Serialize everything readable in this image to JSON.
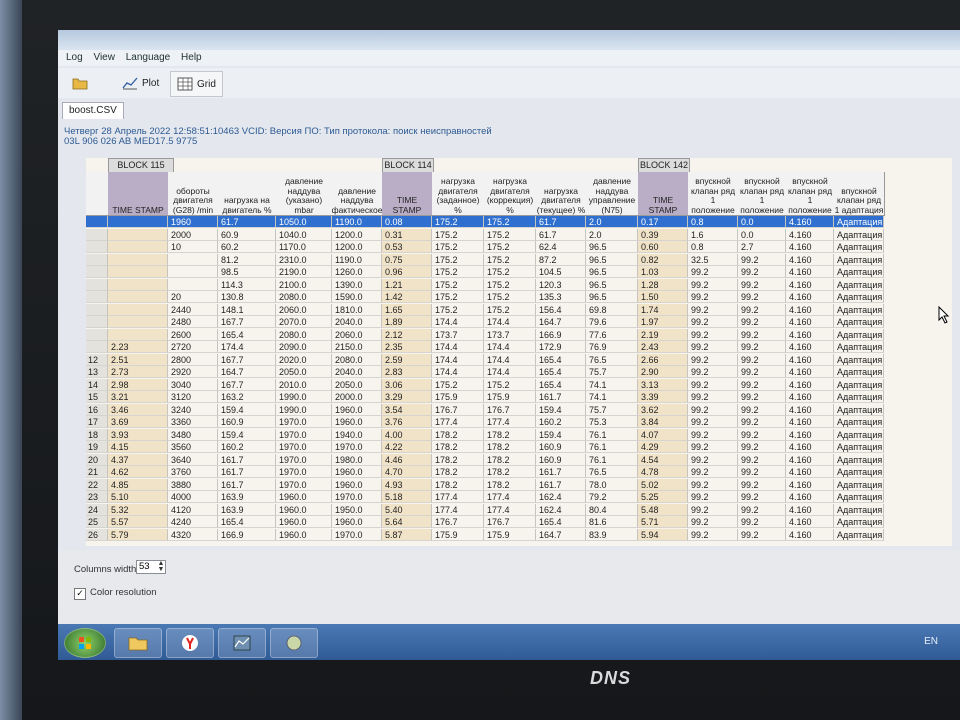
{
  "menu": [
    "Log",
    "View",
    "Language",
    "Help"
  ],
  "toolbar": {
    "plot_label": "Plot",
    "grid_label": "Grid"
  },
  "file_tab": "boost.CSV",
  "info_line1": "Четверг 28 Апрель 2022 12:58:51:10463 VCID: Версия ПО: Тип протокола: поиск неисправностей",
  "info_line2": "03L 906 026 AB  MED17.5                    9775",
  "blocks": [
    {
      "label": "BLOCK 115"
    },
    {
      "label": "BLOCK 114"
    },
    {
      "label": "BLOCK 142"
    }
  ],
  "columns": [
    "TIME STAMP",
    "обороты двигателя (G28) /min",
    "нагрузка на двигатель %",
    "давление наддува (указано) mbar",
    "давление наддува фактическое",
    "TIME STAMP",
    "нагрузка двигателя (заданное) %",
    "нагрузка двигателя (коррекция) %",
    "нагрузка двигателя (текущее) %",
    "давление наддува управление (N75)",
    "TIME STAMP",
    "впускной клапан ряд 1 положение",
    "впускной клапан ряд 1 положение",
    "впускной клапан ряд 1 положение",
    "впускной клапан ряд 1 адаптация"
  ],
  "rows": [
    [
      "",
      "",
      "1960",
      "61.7",
      "1050.0",
      "1190.0",
      "0.08",
      "175.2",
      "175.2",
      "61.7",
      "2.0",
      "0.17",
      "0.8",
      "0.0",
      "4.160",
      "Адаптация"
    ],
    [
      "",
      "",
      "2000",
      "60.9",
      "1040.0",
      "1200.0",
      "0.31",
      "175.2",
      "175.2",
      "61.7",
      "2.0",
      "0.39",
      "1.6",
      "0.0",
      "4.160",
      "Адаптация"
    ],
    [
      "",
      "",
      "10",
      "60.2",
      "1170.0",
      "1200.0",
      "0.53",
      "175.2",
      "175.2",
      "62.4",
      "96.5",
      "0.60",
      "0.8",
      "2.7",
      "4.160",
      "Адаптация"
    ],
    [
      "",
      "",
      "",
      "81.2",
      "2310.0",
      "1190.0",
      "0.75",
      "175.2",
      "175.2",
      "87.2",
      "96.5",
      "0.82",
      "32.5",
      "99.2",
      "4.160",
      "Адаптация"
    ],
    [
      "",
      "",
      "",
      "98.5",
      "2190.0",
      "1260.0",
      "0.96",
      "175.2",
      "175.2",
      "104.5",
      "96.5",
      "1.03",
      "99.2",
      "99.2",
      "4.160",
      "Адаптация"
    ],
    [
      "",
      "",
      "",
      "114.3",
      "2100.0",
      "1390.0",
      "1.21",
      "175.2",
      "175.2",
      "120.3",
      "96.5",
      "1.28",
      "99.2",
      "99.2",
      "4.160",
      "Адаптация"
    ],
    [
      "",
      "",
      "20",
      "130.8",
      "2080.0",
      "1590.0",
      "1.42",
      "175.2",
      "175.2",
      "135.3",
      "96.5",
      "1.50",
      "99.2",
      "99.2",
      "4.160",
      "Адаптация"
    ],
    [
      "",
      "",
      "2440",
      "148.1",
      "2060.0",
      "1810.0",
      "1.65",
      "175.2",
      "175.2",
      "156.4",
      "69.8",
      "1.74",
      "99.2",
      "99.2",
      "4.160",
      "Адаптация"
    ],
    [
      "",
      "",
      "2480",
      "167.7",
      "2070.0",
      "2040.0",
      "1.89",
      "174.4",
      "174.4",
      "164.7",
      "79.6",
      "1.97",
      "99.2",
      "99.2",
      "4.160",
      "Адаптация"
    ],
    [
      "",
      "",
      "2600",
      "165.4",
      "2080.0",
      "2060.0",
      "2.12",
      "173.7",
      "173.7",
      "166.9",
      "77.6",
      "2.19",
      "99.2",
      "99.2",
      "4.160",
      "Адаптация"
    ],
    [
      "",
      "2.23",
      "2720",
      "174.4",
      "2090.0",
      "2150.0",
      "2.35",
      "174.4",
      "174.4",
      "172.9",
      "76.9",
      "2.43",
      "99.2",
      "99.2",
      "4.160",
      "Адаптация"
    ],
    [
      "12",
      "2.51",
      "2800",
      "167.7",
      "2020.0",
      "2080.0",
      "2.59",
      "174.4",
      "174.4",
      "165.4",
      "76.5",
      "2.66",
      "99.2",
      "99.2",
      "4.160",
      "Адаптация"
    ],
    [
      "13",
      "2.73",
      "2920",
      "164.7",
      "2050.0",
      "2040.0",
      "2.83",
      "174.4",
      "174.4",
      "165.4",
      "75.7",
      "2.90",
      "99.2",
      "99.2",
      "4.160",
      "Адаптация"
    ],
    [
      "14",
      "2.98",
      "3040",
      "167.7",
      "2010.0",
      "2050.0",
      "3.06",
      "175.2",
      "175.2",
      "165.4",
      "74.1",
      "3.13",
      "99.2",
      "99.2",
      "4.160",
      "Адаптация"
    ],
    [
      "15",
      "3.21",
      "3120",
      "163.2",
      "1990.0",
      "2000.0",
      "3.29",
      "175.9",
      "175.9",
      "161.7",
      "74.1",
      "3.39",
      "99.2",
      "99.2",
      "4.160",
      "Адаптация"
    ],
    [
      "16",
      "3.46",
      "3240",
      "159.4",
      "1990.0",
      "1960.0",
      "3.54",
      "176.7",
      "176.7",
      "159.4",
      "75.7",
      "3.62",
      "99.2",
      "99.2",
      "4.160",
      "Адаптация"
    ],
    [
      "17",
      "3.69",
      "3360",
      "160.9",
      "1970.0",
      "1960.0",
      "3.76",
      "177.4",
      "177.4",
      "160.2",
      "75.3",
      "3.84",
      "99.2",
      "99.2",
      "4.160",
      "Адаптация"
    ],
    [
      "18",
      "3.93",
      "3480",
      "159.4",
      "1970.0",
      "1940.0",
      "4.00",
      "178.2",
      "178.2",
      "159.4",
      "76.1",
      "4.07",
      "99.2",
      "99.2",
      "4.160",
      "Адаптация"
    ],
    [
      "19",
      "4.15",
      "3560",
      "160.2",
      "1970.0",
      "1970.0",
      "4.22",
      "178.2",
      "178.2",
      "160.9",
      "76.1",
      "4.29",
      "99.2",
      "99.2",
      "4.160",
      "Адаптация"
    ],
    [
      "20",
      "4.37",
      "3640",
      "161.7",
      "1970.0",
      "1980.0",
      "4.46",
      "178.2",
      "178.2",
      "160.9",
      "76.1",
      "4.54",
      "99.2",
      "99.2",
      "4.160",
      "Адаптация"
    ],
    [
      "21",
      "4.62",
      "3760",
      "161.7",
      "1970.0",
      "1960.0",
      "4.70",
      "178.2",
      "178.2",
      "161.7",
      "76.5",
      "4.78",
      "99.2",
      "99.2",
      "4.160",
      "Адаптация"
    ],
    [
      "22",
      "4.85",
      "3880",
      "161.7",
      "1970.0",
      "1960.0",
      "4.93",
      "178.2",
      "178.2",
      "161.7",
      "78.0",
      "5.02",
      "99.2",
      "99.2",
      "4.160",
      "Адаптация"
    ],
    [
      "23",
      "5.10",
      "4000",
      "163.9",
      "1960.0",
      "1970.0",
      "5.18",
      "177.4",
      "177.4",
      "162.4",
      "79.2",
      "5.25",
      "99.2",
      "99.2",
      "4.160",
      "Адаптация"
    ],
    [
      "24",
      "5.32",
      "4120",
      "163.9",
      "1960.0",
      "1950.0",
      "5.40",
      "177.4",
      "177.4",
      "162.4",
      "80.4",
      "5.48",
      "99.2",
      "99.2",
      "4.160",
      "Адаптация"
    ],
    [
      "25",
      "5.57",
      "4240",
      "165.4",
      "1960.0",
      "1960.0",
      "5.64",
      "176.7",
      "176.7",
      "165.4",
      "81.6",
      "5.71",
      "99.2",
      "99.2",
      "4.160",
      "Адаптация"
    ],
    [
      "26",
      "5.79",
      "4320",
      "166.9",
      "1960.0",
      "1970.0",
      "5.87",
      "175.9",
      "175.9",
      "164.7",
      "83.9",
      "5.94",
      "99.2",
      "99.2",
      "4.160",
      "Адаптация"
    ]
  ],
  "columns_width_label": "Columns width:",
  "columns_width_value": "53",
  "color_resolution_label": "Color resolution",
  "color_resolution_checked": "✓",
  "tray_lang": "EN",
  "brand": "DNS",
  "colors": {
    "selection": "#2f6fd0",
    "timestamp_header": "#b9aec6",
    "timestamp_cell": "#f1e3c8"
  }
}
